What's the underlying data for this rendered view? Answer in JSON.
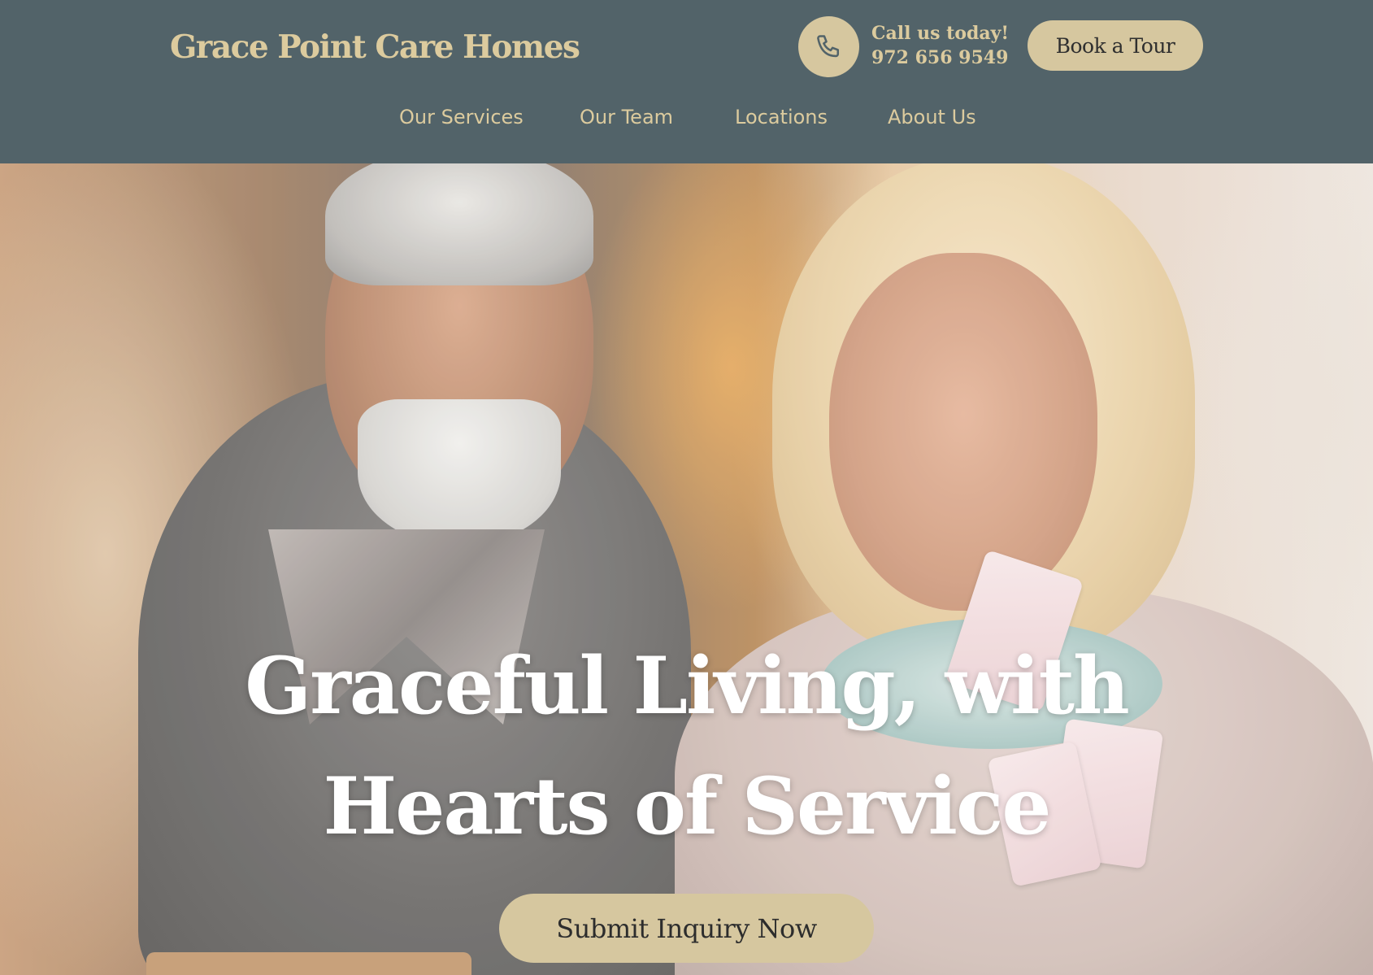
{
  "header": {
    "brand": "Grace Point Care Homes",
    "call_label": "Call us today!",
    "phone_number": "972 656 9549",
    "book_tour_label": "Book a Tour"
  },
  "nav": {
    "items": [
      {
        "label": "Our Services"
      },
      {
        "label": "Our Team"
      },
      {
        "label": "Locations"
      },
      {
        "label": "About Us"
      }
    ]
  },
  "hero": {
    "title_line_1": "Graceful Living, with",
    "title_line_2": "Hearts of Service",
    "cta_label": "Submit Inquiry Now"
  },
  "icons": {
    "phone": "phone-icon"
  },
  "colors": {
    "header_bg": "#526369",
    "accent": "#d6c79f",
    "brand_text": "#dccb9e",
    "hero_text": "#ffffff",
    "button_text": "#2d2d2d"
  }
}
